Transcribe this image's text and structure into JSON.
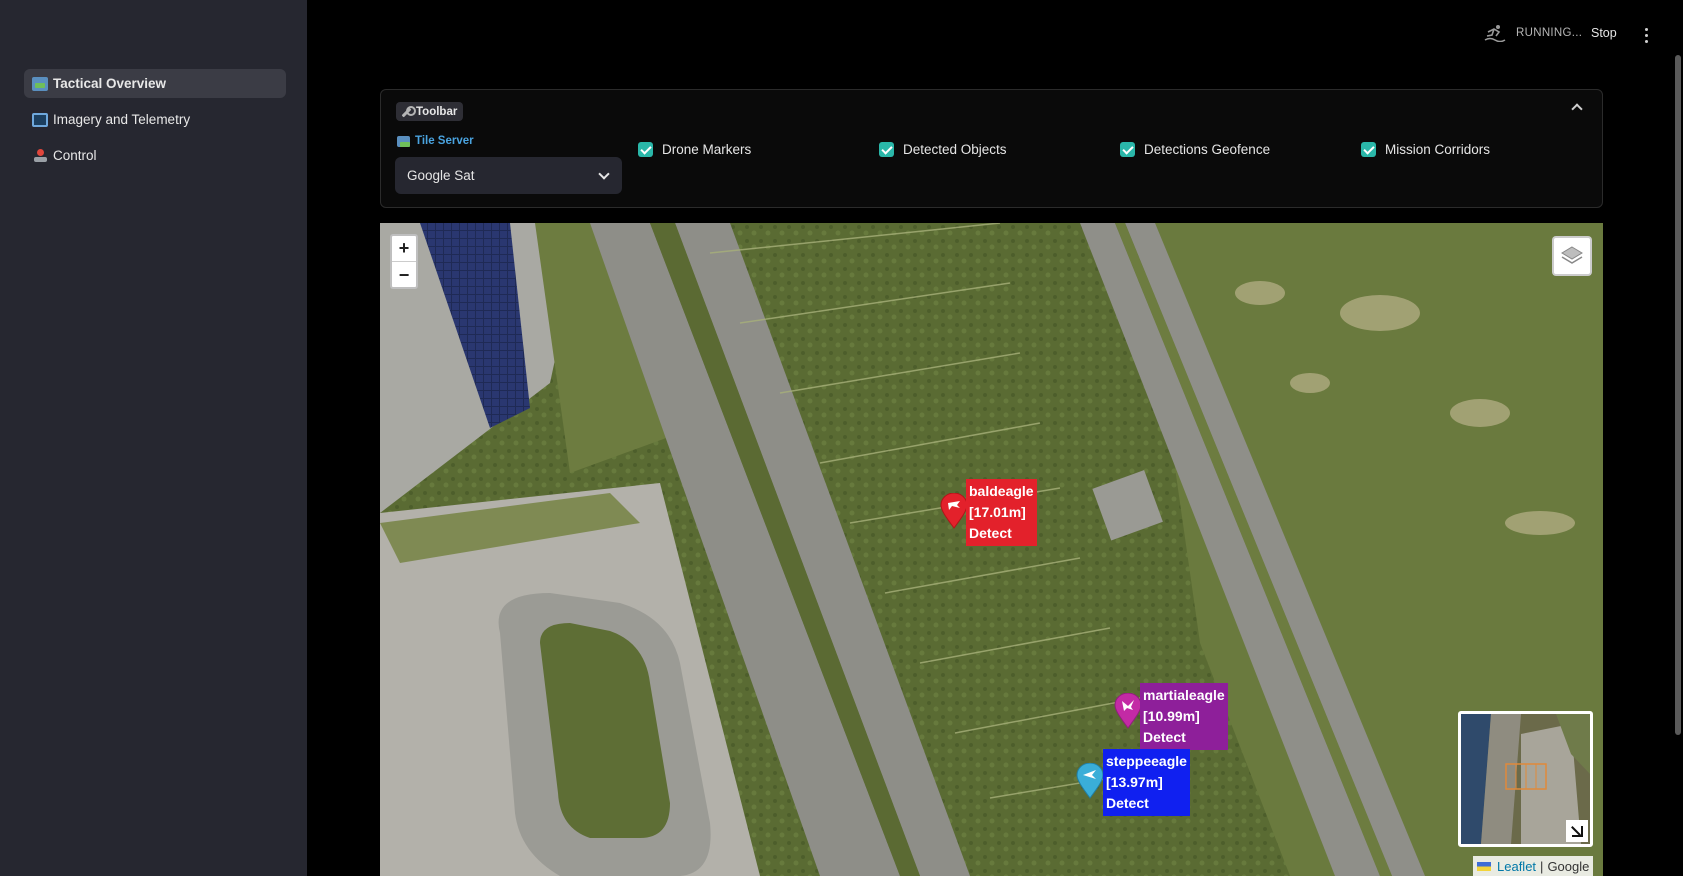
{
  "sidebar": {
    "items": [
      {
        "label": "Tactical Overview",
        "icon": "map-icon",
        "active": true
      },
      {
        "label": "Imagery and Telemetry",
        "icon": "tv-icon"
      },
      {
        "label": "Control",
        "icon": "joystick-icon"
      }
    ]
  },
  "header": {
    "status": "RUNNING...",
    "stop_label": "Stop"
  },
  "toolbar": {
    "title": "Toolbar",
    "tile_server_label": "Tile Server",
    "tile_server_value": "Google Sat",
    "checkboxes": [
      {
        "label": "Drone Markers",
        "checked": true
      },
      {
        "label": "Detected Objects",
        "checked": true
      },
      {
        "label": "Detections Geofence",
        "checked": true
      },
      {
        "label": "Mission Corridors",
        "checked": true
      }
    ]
  },
  "map": {
    "zoom_in": "+",
    "zoom_out": "−",
    "attribution_leaflet": "Leaflet",
    "attribution_sep": "|",
    "attribution_google": "Google",
    "drones": [
      {
        "name": "baldeagle",
        "altitude": "[17.01m]",
        "mode": "Detect",
        "color": "#e3212b"
      },
      {
        "name": "martialeagle",
        "altitude": "[10.99m]",
        "mode": "Detect",
        "color": "#8e1f9a"
      },
      {
        "name": "steppeeagle",
        "altitude": "[13.97m]",
        "mode": "Detect",
        "color": "#1020f0"
      }
    ]
  },
  "colors": {
    "accent": "#2ab7a9",
    "sidebar_bg": "#262730",
    "link": "#4aa3df"
  }
}
